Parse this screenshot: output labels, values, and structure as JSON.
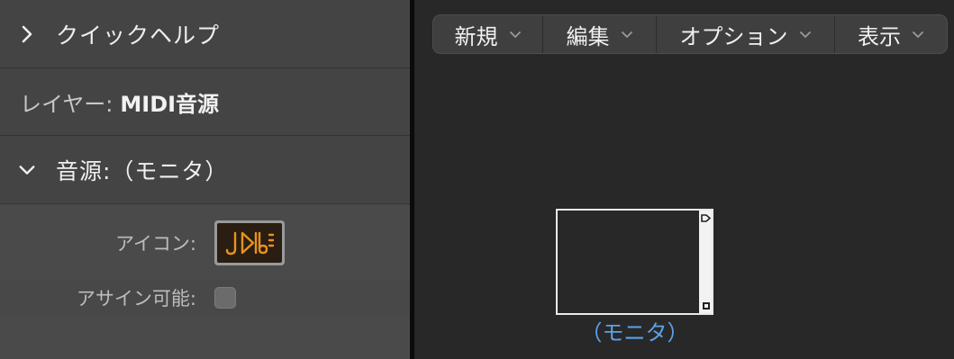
{
  "inspector": {
    "quick_help": "クイックヘルプ",
    "layer_label": "レイヤー:",
    "layer_value": "MIDI音源",
    "instrument_title": "音源:（モニタ）",
    "icon_label": "アイコン:",
    "assignable_label": "アサイン可能:",
    "assignable_checked": false
  },
  "menubar": {
    "new": "新規",
    "edit": "編集",
    "options": "オプション",
    "view": "表示"
  },
  "environment": {
    "object_label": "（モニタ）"
  },
  "colors": {
    "accent_blue": "#5aa2e8",
    "icon_orange": "#e8931c"
  }
}
